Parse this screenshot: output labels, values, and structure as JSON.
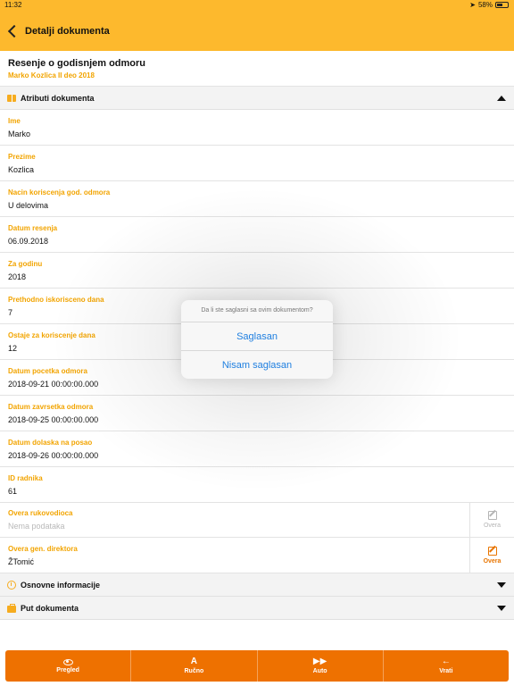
{
  "status_bar": {
    "time": "11:32",
    "battery": "58%",
    "battery_level": 0.58
  },
  "nav": {
    "title": "Detalji dokumenta"
  },
  "document": {
    "title": "Resenje o godisnjem odmoru",
    "subtitle": "Marko Kozlica II deo 2018"
  },
  "sections": {
    "attributes": "Atributi dokumenta",
    "basic_info": "Osnovne informacije",
    "doc_path": "Put dokumenta"
  },
  "fields": [
    {
      "label": "Ime",
      "value": "Marko"
    },
    {
      "label": "Prezime",
      "value": "Kozlica"
    },
    {
      "label": "Nacin koriscenja god. odmora",
      "value": "U delovima"
    },
    {
      "label": "Datum resenja",
      "value": "06.09.2018"
    },
    {
      "label": "Za godinu",
      "value": "2018"
    },
    {
      "label": "Prethodno iskorisceno dana",
      "value": "7"
    },
    {
      "label": "Ostaje za koriscenje dana",
      "value": "12"
    },
    {
      "label": "Datum pocetka odmora",
      "value": "2018-09-21 00:00:00.000"
    },
    {
      "label": "Datum zavrsetka odmora",
      "value": "2018-09-25 00:00:00.000"
    },
    {
      "label": "Datum dolaska na posao",
      "value": "2018-09-26 00:00:00.000"
    },
    {
      "label": "ID radnika",
      "value": "61"
    }
  ],
  "approvals": [
    {
      "label": "Overa rukovodioca",
      "value": "Nema podataka",
      "button": "Overa"
    },
    {
      "label": "Overa gen. direktora",
      "value": "ŽTomić",
      "button": "Overa"
    }
  ],
  "alert": {
    "message": "Da li ste saglasni sa ovim dokumentom?",
    "agree": "Saglasan",
    "disagree": "Nisam saglasan"
  },
  "toolbar": {
    "preview": "Pregled",
    "manual": "Ručno",
    "auto": "Auto",
    "back": "Vrati"
  },
  "colors": {
    "accent": "#FDB92D",
    "label": "#F2A400",
    "toolbar": "#EE7100",
    "link": "#1F7FE0"
  }
}
